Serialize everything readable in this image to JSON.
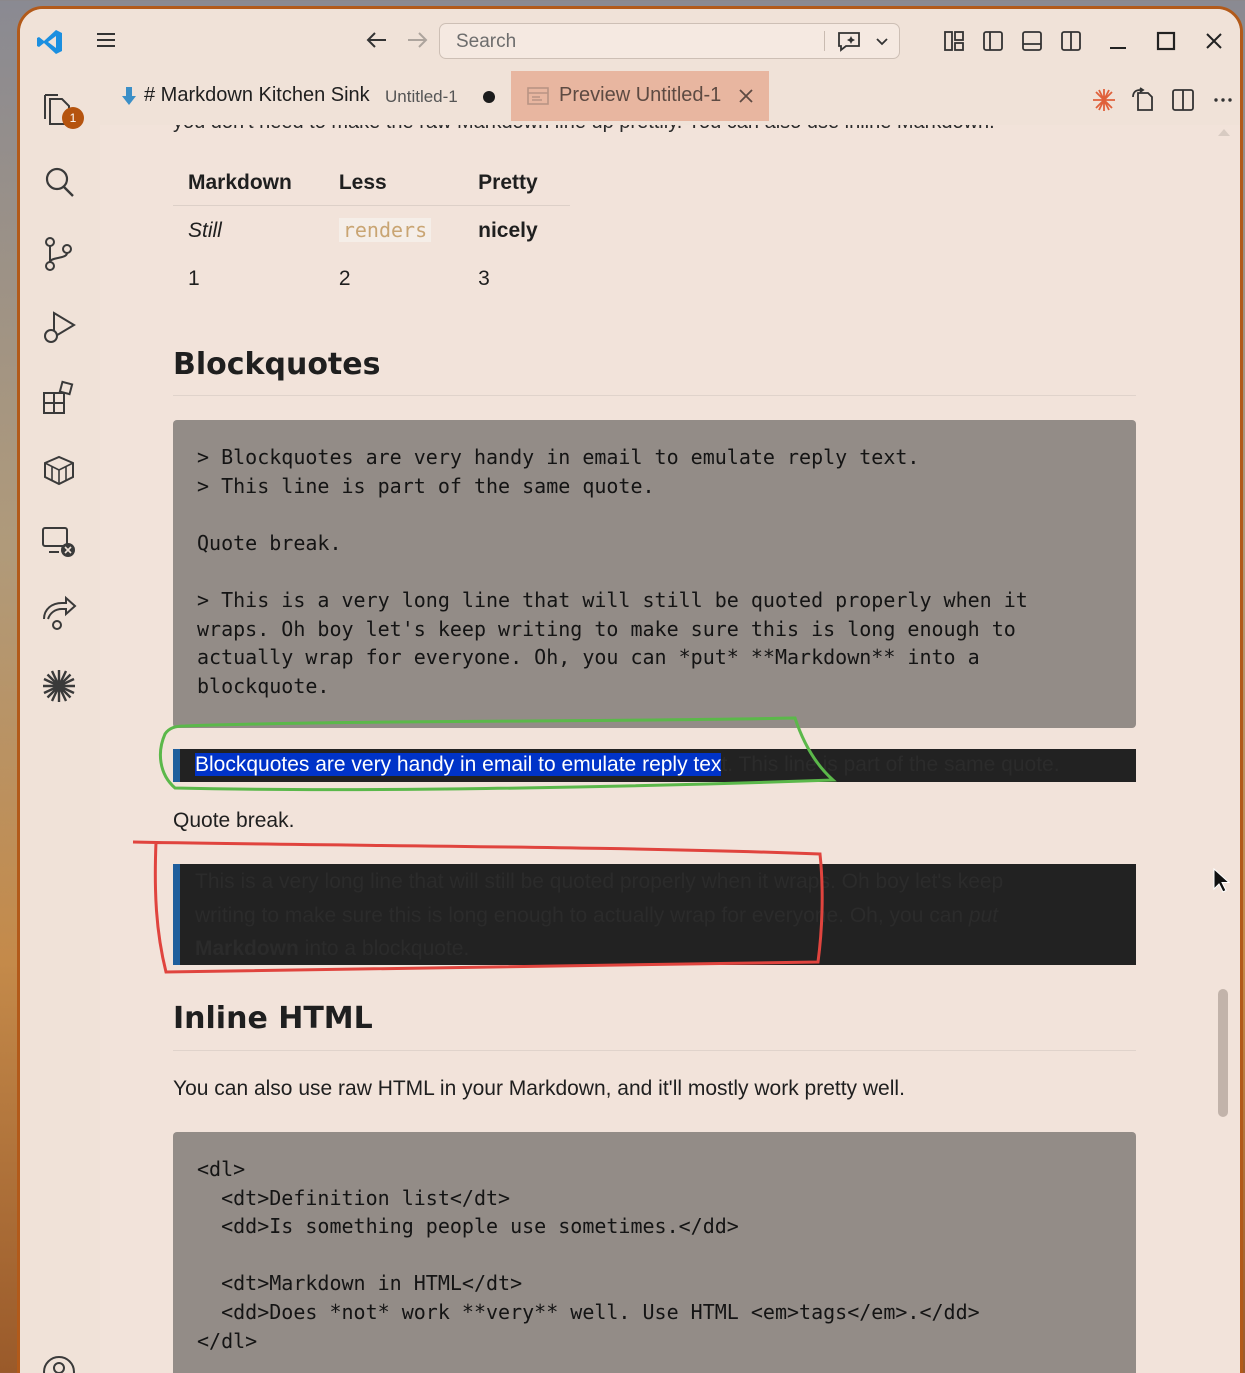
{
  "search": {
    "placeholder": "Search"
  },
  "activity_bar": {
    "explorer_badge": "1",
    "icons": [
      "explorer-icon",
      "search-icon",
      "source-control-icon",
      "run-debug-icon",
      "extensions-icon",
      "packages-icon",
      "remote-explorer-icon",
      "live-share-icon",
      "claude-icon",
      "accounts-icon"
    ]
  },
  "tabs": [
    {
      "title": "# Markdown Kitchen Sink",
      "description": "Untitled-1",
      "dirty": true
    },
    {
      "title": "Preview Untitled-1",
      "active": true
    }
  ],
  "document": {
    "cut_line": "you don't need to make the raw Markdown line up prettily. You can also use inline Markdown.",
    "table": {
      "headers": [
        "Markdown",
        "Less",
        "Pretty"
      ],
      "rows": [
        [
          "Still",
          "renders",
          "nicely"
        ],
        [
          "1",
          "2",
          "3"
        ]
      ]
    },
    "blockquotes_heading": "Blockquotes",
    "blockquotes_code": "> Blockquotes are very handy in email to emulate reply text.\n> This line is part of the same quote.\n\nQuote break.\n\n> This is a very long line that will still be quoted properly when it\nwraps. Oh boy let's keep writing to make sure this is long enough to\nactually wrap for everyone. Oh, you can *put* **Markdown** into a\nblockquote.",
    "quote1_selected": "Blockquotes are very handy in email to emulate reply tex",
    "quote1_rest": "t. This line is part of the same quote.",
    "quote_break": "Quote break.",
    "quote2_line1": "This is a very long line that will still be quoted properly when it wraps. Oh boy let's keep",
    "quote2_line2a": "writing to make sure this is long enough to actually wrap for everyone. Oh, you can ",
    "quote2_put": "put",
    "quote2_markdown": "Markdown",
    "quote2_line3": " into a blockquote.",
    "inline_html_heading": "Inline HTML",
    "inline_html_para": "You can also use raw HTML in your Markdown, and it'll mostly work pretty well.",
    "html_code": "<dl>\n  <dt>Definition list</dt>\n  <dd>Is something people use sometimes.</dd>\n\n  <dt>Markdown in HTML</dt>\n  <dd>Does *not* work **very** well. Use HTML <em>tags</em>.</dd>\n</dl>"
  },
  "colors": {
    "accent": "#b5540f",
    "selection": "#0033c8",
    "annotation_green": "#5bb84a",
    "annotation_red": "#e0443e"
  }
}
